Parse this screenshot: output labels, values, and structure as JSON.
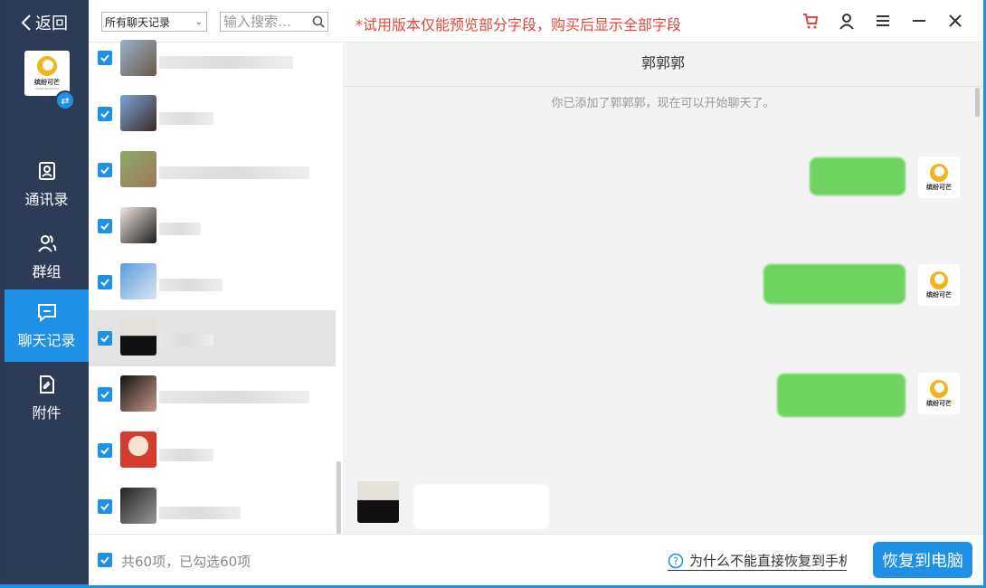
{
  "nav": {
    "back_label": "返回",
    "logo_text": "缤纷可芒",
    "logo_subtext": "COME ON FRUITS",
    "items": [
      {
        "label": "通讯录",
        "icon": "contacts-icon"
      },
      {
        "label": "群组",
        "icon": "group-icon"
      },
      {
        "label": "聊天记录",
        "icon": "chat-icon",
        "active": true
      },
      {
        "label": "附件",
        "icon": "attachment-icon"
      }
    ]
  },
  "list": {
    "filter_value": "所有聊天记录",
    "search_placeholder": "输入搜索…",
    "rows": [
      {
        "checked": true
      },
      {
        "checked": true
      },
      {
        "checked": true
      },
      {
        "checked": true
      },
      {
        "checked": true
      },
      {
        "checked": true,
        "selected": true
      },
      {
        "checked": true
      },
      {
        "checked": true
      },
      {
        "checked": true
      }
    ]
  },
  "topbar": {
    "trial_note": "*试用版本仅能预览部分字段，购买后显示全部字段"
  },
  "chat": {
    "contact_name": "郭郭郭",
    "system_message": "你已添加了郭郭郭，现在可以开始聊天了。"
  },
  "bottom": {
    "count_text": "共60项，已勾选60项",
    "help_text": "为什么不能直接恢复到手机",
    "restore_button": "恢复到电脑"
  },
  "colors": {
    "accent": "#1e90e6",
    "nav_bg": "#2e3b57",
    "trial_red": "#e5463c",
    "bubble_green": "#6ed35f"
  }
}
